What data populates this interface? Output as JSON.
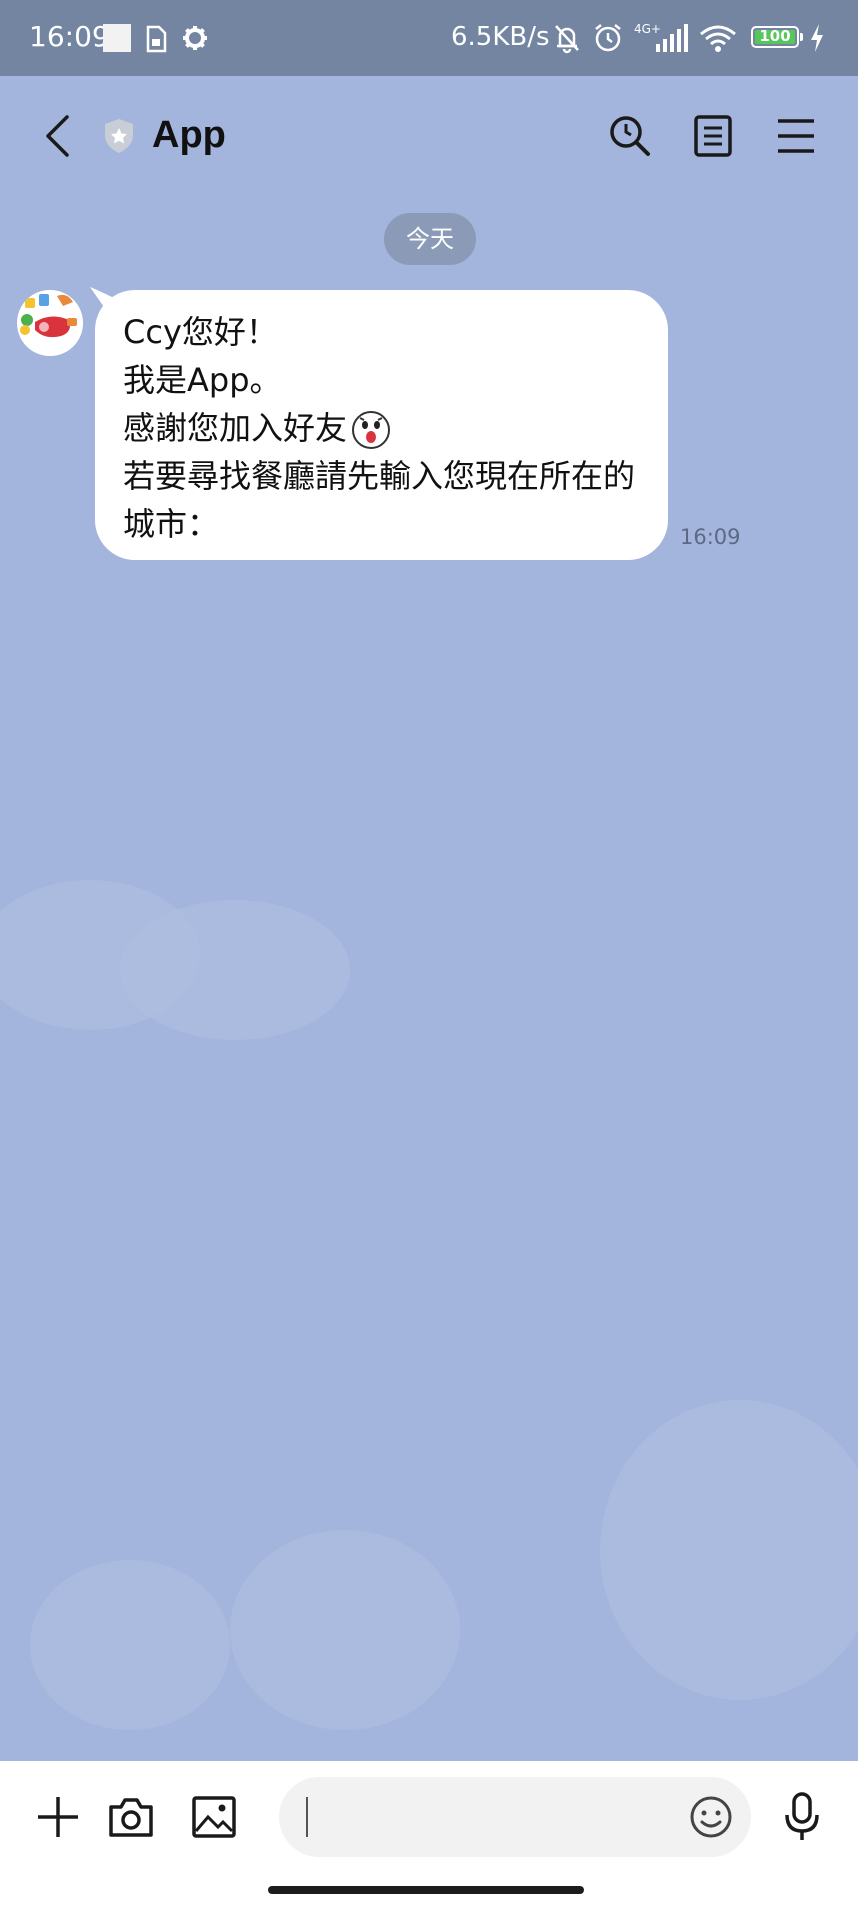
{
  "status_bar": {
    "time": "16:09",
    "net_speed": "6.5KB/s",
    "network_type": "4G+",
    "battery_level": "100",
    "icons": [
      "notification-square-icon",
      "sim-icon",
      "gear-icon",
      "bell-off-icon",
      "alarm-icon",
      "signal-icon",
      "wifi-icon",
      "battery-icon",
      "charging-icon"
    ]
  },
  "header": {
    "title": "App",
    "icons": [
      "back-arrow-icon",
      "shield-badge-icon",
      "search-icon",
      "notes-icon",
      "menu-icon"
    ]
  },
  "chat": {
    "date_separator": "今天",
    "messages": [
      {
        "sender_avatar": "food-avatar",
        "lines": [
          "Ccy您好！",
          "我是App。",
          "感謝您加入好友",
          "若要尋找餐廳請先輸入您現在所在的城市："
        ],
        "emoji": "surprised-face-emoji",
        "time": "16:09"
      }
    ]
  },
  "composer": {
    "input_value": "",
    "input_placeholder": "",
    "icons": [
      "plus-icon",
      "camera-icon",
      "image-icon",
      "emoji-icon",
      "microphone-icon"
    ]
  },
  "colors": {
    "chat_background": "#a3b5dc",
    "status_bar": "#7385a0",
    "bubble": "#ffffff",
    "date_pill": "#8a9ab7",
    "battery_fill": "#56c75a"
  }
}
